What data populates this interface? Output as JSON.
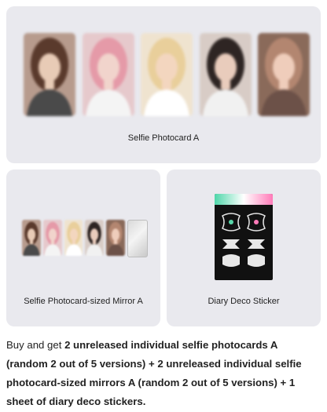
{
  "top_card": {
    "label": "Selfie Photocard A",
    "photos": [
      {
        "name": "member-1",
        "bg": "#b79b8d",
        "skin": "#e8cbb6",
        "hair": "#5a3a2c",
        "shirt": "#4a4a4a"
      },
      {
        "name": "member-2",
        "bg": "#e6c9cc",
        "skin": "#f1d4cc",
        "hair": "#e59aa8",
        "shirt": "#f4f4f4"
      },
      {
        "name": "member-3",
        "bg": "#efe3cf",
        "skin": "#f3d6bf",
        "hair": "#e9cf9b",
        "shirt": "#ffffff"
      },
      {
        "name": "member-4",
        "bg": "#d8ccc6",
        "skin": "#e9ccbc",
        "hair": "#2e2523",
        "shirt": "#f1f1f1"
      },
      {
        "name": "member-5",
        "bg": "#8a6a5a",
        "skin": "#efcdbb",
        "hair": "#b38670",
        "shirt": "#6c5148"
      }
    ]
  },
  "left_card": {
    "label": "Selfie Photocard-sized Mirror A"
  },
  "right_card": {
    "label": "Diary Deco Sticker"
  },
  "description": {
    "prefix": "Buy and get ",
    "bold": "2 unreleased individual selfie photocards A (random 2 out of 5 versions) + 2 unreleased individual selfie photocard-sized mirrors A (random 2 out of 5 versions) + 1 sheet of diary deco stickers."
  }
}
